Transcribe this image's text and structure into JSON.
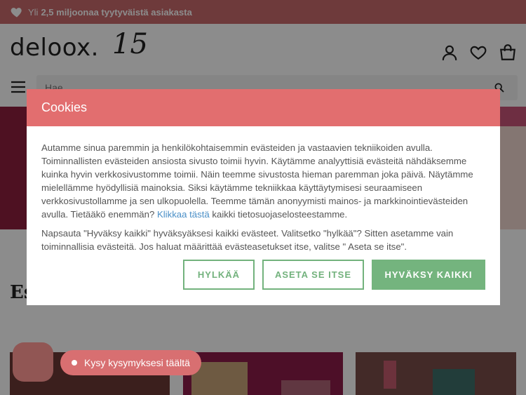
{
  "topbar": {
    "prefix": "Yli",
    "highlight": "2,5 miljoonaa tyytyväistä asiakasta"
  },
  "header": {
    "logo_text": "deloox.",
    "logo_badge": "15"
  },
  "search": {
    "placeholder": "Hae ..."
  },
  "section": {
    "title": "Es"
  },
  "chat": {
    "label": "Kysy kysymyksesi täältä"
  },
  "cookie": {
    "title": "Cookies",
    "para1_before": "Autamme sinua paremmin ja henkilökohtaisemmin evästeiden ja vastaavien tekniikoiden avulla. Toiminnallisten evästeiden ansiosta sivusto toimii hyvin. Käytämme analyyttisiä evästeitä nähdäksemme kuinka hyvin verkkosivustomme toimii. Näin teemme sivustosta hieman paremman joka päivä. Näytämme mielellämme hyödyllisiä mainoksia. Siksi käytämme tekniikkaa käyttäytymisesi seuraamiseen verkkosivustollamme ja sen ulkopuolella. Teemme tämän anonyymisti mainos- ja markkinointievästeiden avulla. Tietääkö enemmän?",
    "link": "Klikkaa tästä",
    "para1_after": "kaikki tietosuojaselosteestamme.",
    "para2": "Napsauta \"Hyväksy kaikki\" hyväksyäksesi kaikki evästeet. Valitsetko \"hylkää\"? Sitten asetamme vain toiminnallisia evästeitä. Jos haluat määrittää evästeasetukset itse, valitse \" Aseta se itse\".",
    "btn_reject": "HYLKÄÄ",
    "btn_custom": "ASETA SE ITSE",
    "btn_accept": "HYVÄKSY KAIKKI"
  },
  "colors": {
    "brand": "#e26e6f",
    "accept": "#74b47e",
    "topbar": "#c96a6c"
  },
  "icons": [
    "heart-icon",
    "user-icon",
    "wishlist-heart-icon",
    "cart-icon",
    "menu-icon",
    "search-icon"
  ]
}
